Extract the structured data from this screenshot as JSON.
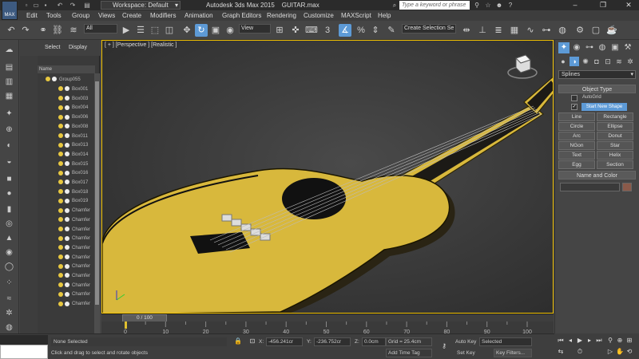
{
  "titlebar": {
    "logo_label": "MAX",
    "workspace": "Workspace: Default",
    "app_title": "Autodesk 3ds Max  2015",
    "file_name": "GUITAR.max",
    "search_placeholder": "Type a keyword or phrase"
  },
  "menu": [
    "Edit",
    "Tools",
    "Group",
    "Views",
    "Create",
    "Modifiers",
    "Animation",
    "Graph Editors",
    "Rendering",
    "Customize",
    "MAXScript",
    "Help"
  ],
  "toolbar": {
    "selection_filter": "All",
    "ref_coord": "View",
    "named_selection": "Create Selection Se"
  },
  "scene_explorer": {
    "tabs": [
      "Select",
      "Display"
    ],
    "column_header": "Name",
    "group_name": "Group055",
    "items": [
      "Box001",
      "Box003",
      "Box004",
      "Box006",
      "Box008",
      "Box011",
      "Box013",
      "Box014",
      "Box015",
      "Box016",
      "Box017",
      "Box018",
      "Box019",
      "Chamfer",
      "Chamfer",
      "Chamfer",
      "Chamfer",
      "Chamfer",
      "Chamfer",
      "Chamfer",
      "Chamfer",
      "Chamfer",
      "Chamfer",
      "Chamfer"
    ]
  },
  "viewport": {
    "label": "[ + ] [Perspective ] [Realistic ]"
  },
  "command_panel": {
    "category": "Splines",
    "object_type_header": "Object Type",
    "autogrid_label": "AutoGrid",
    "start_new_shape": "Start New Shape",
    "shape_buttons": [
      "Line",
      "Rectangle",
      "Circle",
      "Ellipse",
      "Arc",
      "Donut",
      "NGon",
      "Star",
      "Text",
      "Helix",
      "Egg",
      "Section"
    ],
    "name_color_header": "Name and Color",
    "object_color": "#8a5a4a"
  },
  "timeline": {
    "frame_display": "0 / 100",
    "ticks": [
      "0",
      "10",
      "20",
      "30",
      "40",
      "50",
      "60",
      "70",
      "80",
      "90",
      "100"
    ]
  },
  "status": {
    "selection": "None Selected",
    "prompt": "Click and drag to select and rotate objects",
    "x_label": "X:",
    "x_value": "-456.241cr",
    "y_label": "Y:",
    "y_value": "-236.752cr",
    "z_label": "Z:",
    "z_value": "0.0cm",
    "grid": "Grid = 25.4cm",
    "add_time_tag": "Add Time Tag",
    "auto_key": "Auto Key",
    "key_mode": "Selected",
    "set_key": "Set Key",
    "key_filters": "Key Filters..."
  },
  "colors": {
    "accent": "#5d9ad6",
    "viewport_border": "#f0c000",
    "guitar_body": "#d8b83c"
  }
}
